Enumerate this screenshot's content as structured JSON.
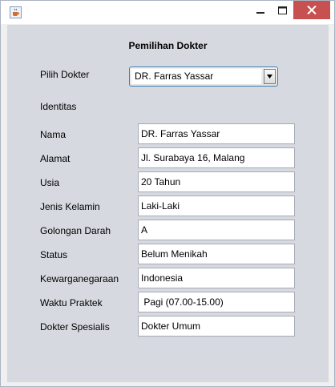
{
  "window": {
    "heading": "Pemilihan Dokter"
  },
  "doctor_select": {
    "label": "Pilih Dokter",
    "selected": "DR. Farras Yassar"
  },
  "section_label": "Identitas",
  "fields": [
    {
      "label": "Nama",
      "value": "DR. Farras Yassar"
    },
    {
      "label": "Alamat",
      "value": "Jl. Surabaya 16, Malang"
    },
    {
      "label": "Usia",
      "value": "20 Tahun"
    },
    {
      "label": "Jenis Kelamin",
      "value": "Laki-Laki"
    },
    {
      "label": "Golongan Darah",
      "value": "A"
    },
    {
      "label": "Status",
      "value": "Belum Menikah"
    },
    {
      "label": "Kewarganegaraan",
      "value": "Indonesia"
    },
    {
      "label": "Waktu Praktek",
      "value": " Pagi (07.00-15.00)"
    },
    {
      "label": "Dokter Spesialis",
      "value": "Dokter Umum"
    }
  ],
  "colors": {
    "client_bg": "#d6d9df",
    "close_button": "#c75050",
    "combo_border": "#3c7fb1"
  },
  "icons": {
    "app": "java-cup-icon",
    "minimize": "minimize-icon",
    "maximize": "maximize-icon",
    "close": "close-icon",
    "dropdown": "chevron-down-icon"
  }
}
